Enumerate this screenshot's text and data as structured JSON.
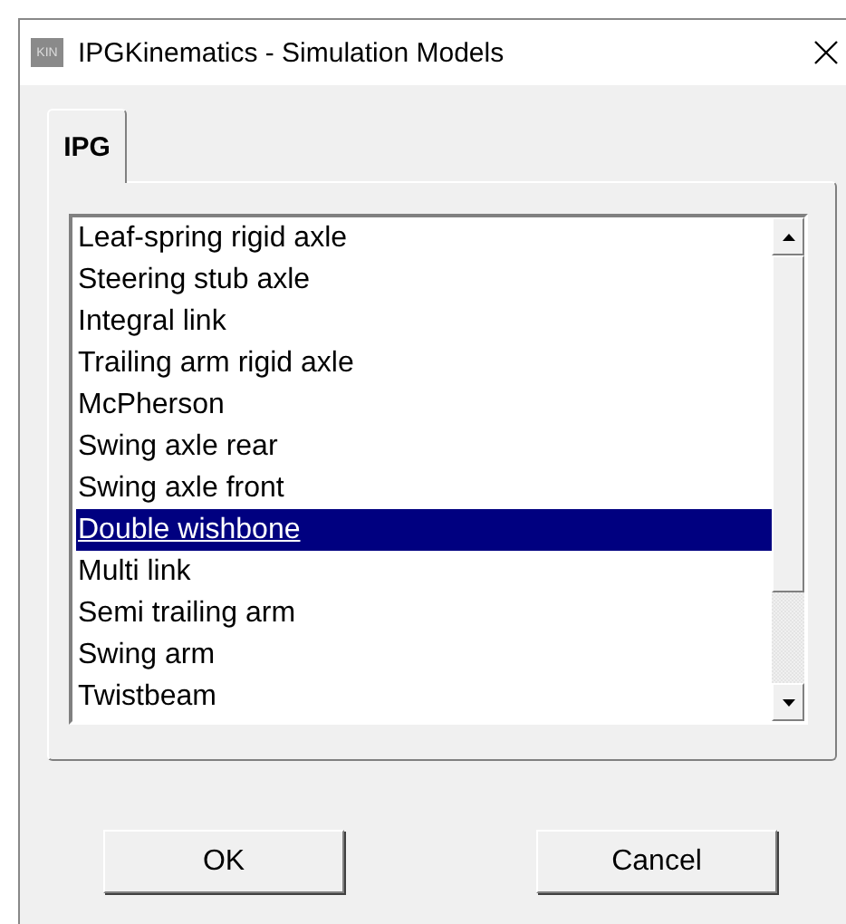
{
  "window": {
    "icon_text": "KIN",
    "title": "IPGKinematics - Simulation Models"
  },
  "tabs": [
    {
      "label": "IPG",
      "selected": true
    }
  ],
  "models": [
    {
      "label": "Leaf-spring rigid axle",
      "selected": false
    },
    {
      "label": "Steering stub axle",
      "selected": false
    },
    {
      "label": "Integral link",
      "selected": false
    },
    {
      "label": "Trailing arm rigid axle",
      "selected": false
    },
    {
      "label": "McPherson",
      "selected": false
    },
    {
      "label": "Swing axle rear",
      "selected": false
    },
    {
      "label": "Swing axle front",
      "selected": false
    },
    {
      "label": "Double wishbone",
      "selected": true
    },
    {
      "label": "Multi link",
      "selected": false
    },
    {
      "label": "Semi trailing arm",
      "selected": false
    },
    {
      "label": "Swing arm",
      "selected": false
    },
    {
      "label": "Twistbeam",
      "selected": false
    }
  ],
  "buttons": [
    "OK",
    "Cancel"
  ]
}
